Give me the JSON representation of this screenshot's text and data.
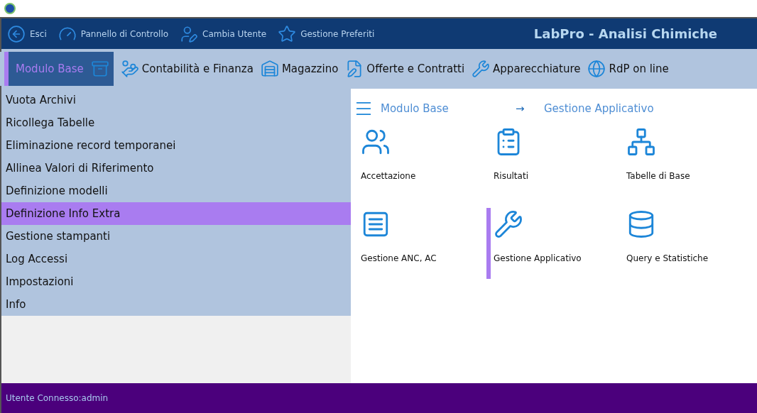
{
  "top_bar": {
    "actions": [
      {
        "label": "Esci"
      },
      {
        "label": "Pannello di Controllo"
      },
      {
        "label": "Cambia Utente"
      },
      {
        "label": "Gestione Preferiti"
      }
    ],
    "title": "LabPro - Analisi Chimiche"
  },
  "modules": [
    {
      "label": "Modulo Base",
      "selected": true
    },
    {
      "label": "Contabilità e Finanza",
      "selected": false
    },
    {
      "label": "Magazzino",
      "selected": false
    },
    {
      "label": "Offerte e Contratti",
      "selected": false
    },
    {
      "label": "Apparecchiature",
      "selected": false
    },
    {
      "label": "RdP on line",
      "selected": false
    }
  ],
  "menu": [
    {
      "label": "Vuota Archivi",
      "selected": false
    },
    {
      "label": "Ricollega Tabelle",
      "selected": false
    },
    {
      "label": "Eliminazione record temporanei",
      "selected": false
    },
    {
      "label": "Allinea Valori di Riferimento",
      "selected": false
    },
    {
      "label": "Definizione modelli",
      "selected": false
    },
    {
      "label": "Definizione Info Extra",
      "selected": true
    },
    {
      "label": "Gestione stampanti",
      "selected": false
    },
    {
      "label": "Log Accessi",
      "selected": false
    },
    {
      "label": "Impostazioni",
      "selected": false
    },
    {
      "label": "Info",
      "selected": false
    }
  ],
  "breadcrumb": {
    "module": "Modulo Base",
    "separator": "→",
    "page": "Gestione Applicativo"
  },
  "tiles": [
    {
      "label": "Accettazione",
      "selected": false
    },
    {
      "label": "Risultati",
      "selected": false
    },
    {
      "label": "Tabelle di Base",
      "selected": false
    },
    {
      "label": "Gestione ANC, AC",
      "selected": false
    },
    {
      "label": "Gestione Applicativo",
      "selected": true
    },
    {
      "label": "Query e Statistiche",
      "selected": false
    }
  ],
  "status_bar": {
    "text": "Utente Connesso:admin"
  }
}
